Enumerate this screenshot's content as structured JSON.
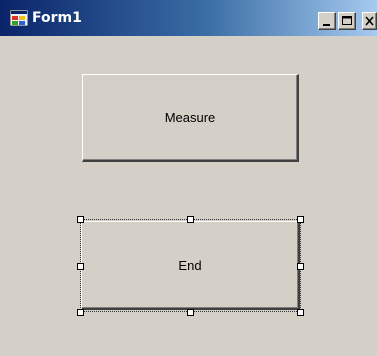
{
  "window": {
    "title": "Form1"
  },
  "buttons": {
    "measure_label": "Measure",
    "end_label": "End"
  },
  "icons": {
    "app": "form-icon",
    "minimize": "minimize-icon",
    "maximize": "maximize-icon",
    "close": "close-icon"
  },
  "colors": {
    "titlebar_start": "#0a246a",
    "titlebar_end": "#a6caf0",
    "form_background": "#d4d0c8"
  }
}
